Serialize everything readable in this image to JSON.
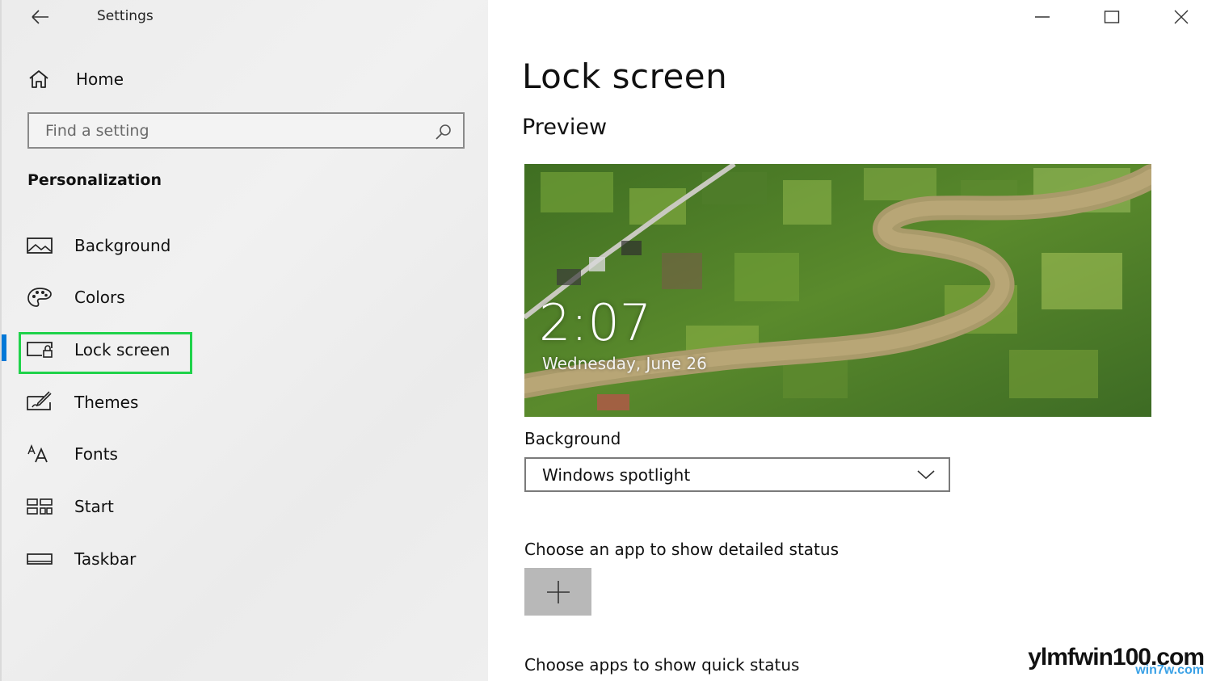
{
  "app": {
    "title": "Settings"
  },
  "sidebar": {
    "home_label": "Home",
    "search": {
      "placeholder": "Find a setting",
      "value": ""
    },
    "section_header": "Personalization",
    "items": [
      {
        "label": "Background",
        "icon": "picture-icon"
      },
      {
        "label": "Colors",
        "icon": "palette-icon"
      },
      {
        "label": "Lock screen",
        "icon": "lock-screen-icon",
        "selected": true
      },
      {
        "label": "Themes",
        "icon": "themes-brush-icon"
      },
      {
        "label": "Fonts",
        "icon": "fonts-icon"
      },
      {
        "label": "Start",
        "icon": "start-tiles-icon"
      },
      {
        "label": "Taskbar",
        "icon": "taskbar-icon"
      }
    ]
  },
  "main": {
    "page_title": "Lock screen",
    "preview_heading": "Preview",
    "preview": {
      "time": "2:07",
      "date": "Wednesday, June 26"
    },
    "background_label": "Background",
    "background_dropdown_value": "Windows spotlight",
    "detailed_status_label": "Choose an app to show detailed status",
    "quick_status_label": "Choose apps to show quick status"
  },
  "watermark": {
    "main": "ylmfwin100.com",
    "sub": "win7w.com"
  },
  "colors": {
    "accent": "#0078d7",
    "highlight_box": "#1fd24a",
    "sidebar_bg": "#efefef",
    "add_button_bg": "#b8b8b8"
  }
}
